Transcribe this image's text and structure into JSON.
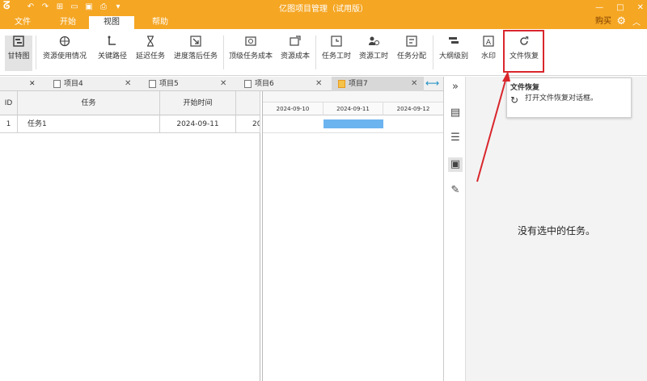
{
  "app": {
    "title": "亿图项目管理（试用版）"
  },
  "menu": {
    "tabs": [
      "文件",
      "开始",
      "视图",
      "帮助"
    ],
    "active": "视图",
    "buy": "购买"
  },
  "ribbon": {
    "buttons": [
      {
        "label": "甘特图"
      },
      {
        "label": "资源使用情况"
      },
      {
        "label": "关键路径"
      },
      {
        "label": "延迟任务"
      },
      {
        "label": "进度落后任务"
      },
      {
        "label": "顶级任务成本"
      },
      {
        "label": "资源成本"
      },
      {
        "label": "任务工时"
      },
      {
        "label": "资源工时"
      },
      {
        "label": "任务分配"
      },
      {
        "label": "大纲级别"
      },
      {
        "label": "水印"
      },
      {
        "label": "文件恢复"
      }
    ]
  },
  "doc_tabs": [
    "项目4",
    "项目5",
    "项目6",
    "项目7"
  ],
  "table": {
    "headers": [
      "ID",
      "任务",
      "开始时间"
    ],
    "rows": [
      {
        "id": "1",
        "task": "任务1",
        "start": "2024-09-11",
        "next": "20"
      }
    ]
  },
  "gantt": {
    "dates": [
      "2024-09-10",
      "2024-09-11",
      "2024-09-12"
    ]
  },
  "tooltip": {
    "title": "文件恢复",
    "desc": "打开文件恢复对话框。"
  },
  "panel": {
    "message": "没有选中的任务。"
  },
  "colors": {
    "accent": "#f5a623",
    "highlight": "#d9262c",
    "bar": "#6cb4f0"
  }
}
